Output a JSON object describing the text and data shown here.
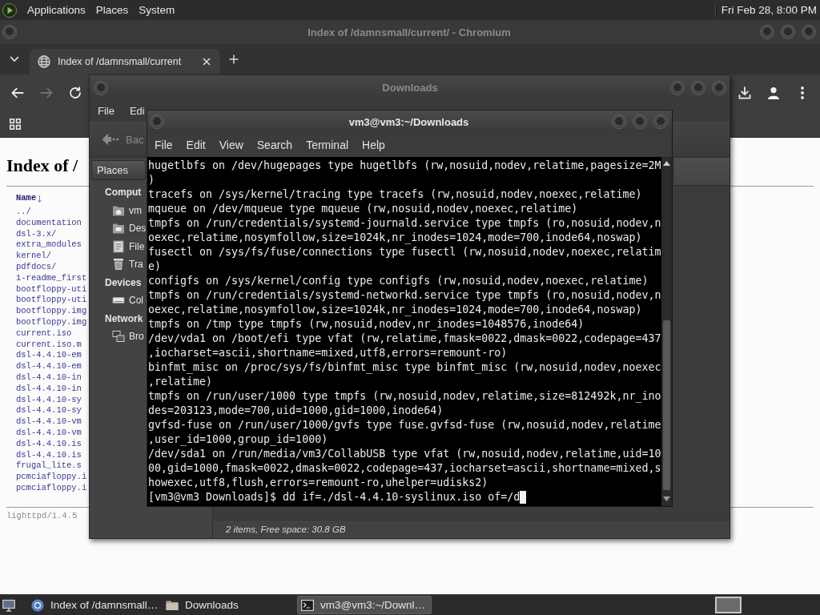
{
  "top_panel": {
    "menus": [
      "Applications",
      "Places",
      "System"
    ],
    "clock": "Fri Feb 28, 8:00 PM"
  },
  "browser": {
    "title": "Index of /damnsmall/current/ - Chromium",
    "active": false,
    "tabs": [
      {
        "label": "Index of /damnsmall/current",
        "selected": true
      }
    ],
    "nav": [
      {
        "kind": "back",
        "disabled": false
      },
      {
        "kind": "forward",
        "disabled": true
      },
      {
        "kind": "reload",
        "disabled": false
      }
    ],
    "page": {
      "heading": "Index of /",
      "column_header": "Name",
      "entries": [
        "../",
        "documentation",
        "dsl-3.x/",
        "extra_modules",
        "kernel/",
        "pdfdocs/",
        "1-readme_first",
        "bootfloppy-uti",
        "bootfloppy-uti",
        "bootfloppy.img",
        "bootfloppy.img",
        "current.iso",
        "current.iso.m",
        "dsl-4.4.10-em",
        "dsl-4.4.10-em",
        "dsl-4.4.10-in",
        "dsl-4.4.10-in",
        "dsl-4.4.10-sy",
        "dsl-4.4.10-sy",
        "dsl-4.4.10-vm",
        "dsl-4.4.10-vm",
        "dsl-4.4.10.is",
        "dsl-4.4.10.is",
        "frugal_lite.s",
        "pcmciafloppy.i",
        "pcmciafloppy.i"
      ],
      "footer": "lighttpd/1.4.5"
    }
  },
  "file_manager": {
    "title": "Downloads",
    "active": false,
    "menus": [
      "File",
      "Edi"
    ],
    "back": {
      "label": "Bac",
      "disabled": true
    },
    "sidebar": {
      "selector": "Places",
      "sections": [
        {
          "heading": "Comput",
          "items": [
            {
              "label": "vm",
              "kind": "home"
            },
            {
              "label": "Des",
              "kind": "desktop"
            },
            {
              "label": "File",
              "kind": "filesystem"
            },
            {
              "label": "Tra",
              "kind": "trash"
            }
          ]
        },
        {
          "heading": "Devices",
          "items": [
            {
              "label": "Col",
              "kind": "drive"
            }
          ]
        },
        {
          "heading": "Network",
          "items": [
            {
              "label": "Bro",
              "kind": "network"
            }
          ]
        }
      ]
    },
    "status": "2 items, Free space: 30.8 GB"
  },
  "terminal": {
    "title": "vm3@vm3:~/Downloads",
    "active": true,
    "menus": [
      "File",
      "Edit",
      "View",
      "Search",
      "Terminal",
      "Help"
    ],
    "lines": [
      "hugetlbfs on /dev/hugepages type hugetlbfs (rw,nosuid,nodev,relatime,pagesize=2M",
      ")",
      "tracefs on /sys/kernel/tracing type tracefs (rw,nosuid,nodev,noexec,relatime)",
      "mqueue on /dev/mqueue type mqueue (rw,nosuid,nodev,noexec,relatime)",
      "tmpfs on /run/credentials/systemd-journald.service type tmpfs (ro,nosuid,nodev,n",
      "oexec,relatime,nosymfollow,size=1024k,nr_inodes=1024,mode=700,inode64,noswap)",
      "fusectl on /sys/fs/fuse/connections type fusectl (rw,nosuid,nodev,noexec,relatim",
      "e)",
      "configfs on /sys/kernel/config type configfs (rw,nosuid,nodev,noexec,relatime)",
      "tmpfs on /run/credentials/systemd-networkd.service type tmpfs (ro,nosuid,nodev,n",
      "oexec,relatime,nosymfollow,size=1024k,nr_inodes=1024,mode=700,inode64,noswap)",
      "tmpfs on /tmp type tmpfs (rw,nosuid,nodev,nr_inodes=1048576,inode64)",
      "/dev/vda1 on /boot/efi type vfat (rw,relatime,fmask=0022,dmask=0022,codepage=437",
      ",iocharset=ascii,shortname=mixed,utf8,errors=remount-ro)",
      "binfmt_misc on /proc/sys/fs/binfmt_misc type binfmt_misc (rw,nosuid,nodev,noexec",
      ",relatime)",
      "tmpfs on /run/user/1000 type tmpfs (rw,nosuid,nodev,relatime,size=812492k,nr_ino",
      "des=203123,mode=700,uid=1000,gid=1000,inode64)",
      "gvfsd-fuse on /run/user/1000/gvfs type fuse.gvfsd-fuse (rw,nosuid,nodev,relatime",
      ",user_id=1000,group_id=1000)",
      "/dev/sda1 on /run/media/vm3/CollabUSB type vfat (rw,nosuid,nodev,relatime,uid=10",
      "00,gid=1000,fmask=0022,dmask=0022,codepage=437,iocharset=ascii,shortname=mixed,s",
      "howexec,utf8,flush,errors=remount-ro,uhelper=udisks2)"
    ],
    "prompt": "[vm3@vm3 Downloads]$ dd if=./dsl-4.4.10-syslinux.iso of=/d"
  },
  "taskbar": {
    "items": [
      {
        "label": "Index of /damnsmall…",
        "kind": "browser",
        "selected": false
      },
      {
        "label": "Downloads",
        "kind": "folder",
        "selected": false
      },
      {
        "label": "vm3@vm3:~/Downl…",
        "kind": "terminal",
        "selected": true
      }
    ],
    "workspaces": [
      {
        "selected": true
      }
    ]
  }
}
